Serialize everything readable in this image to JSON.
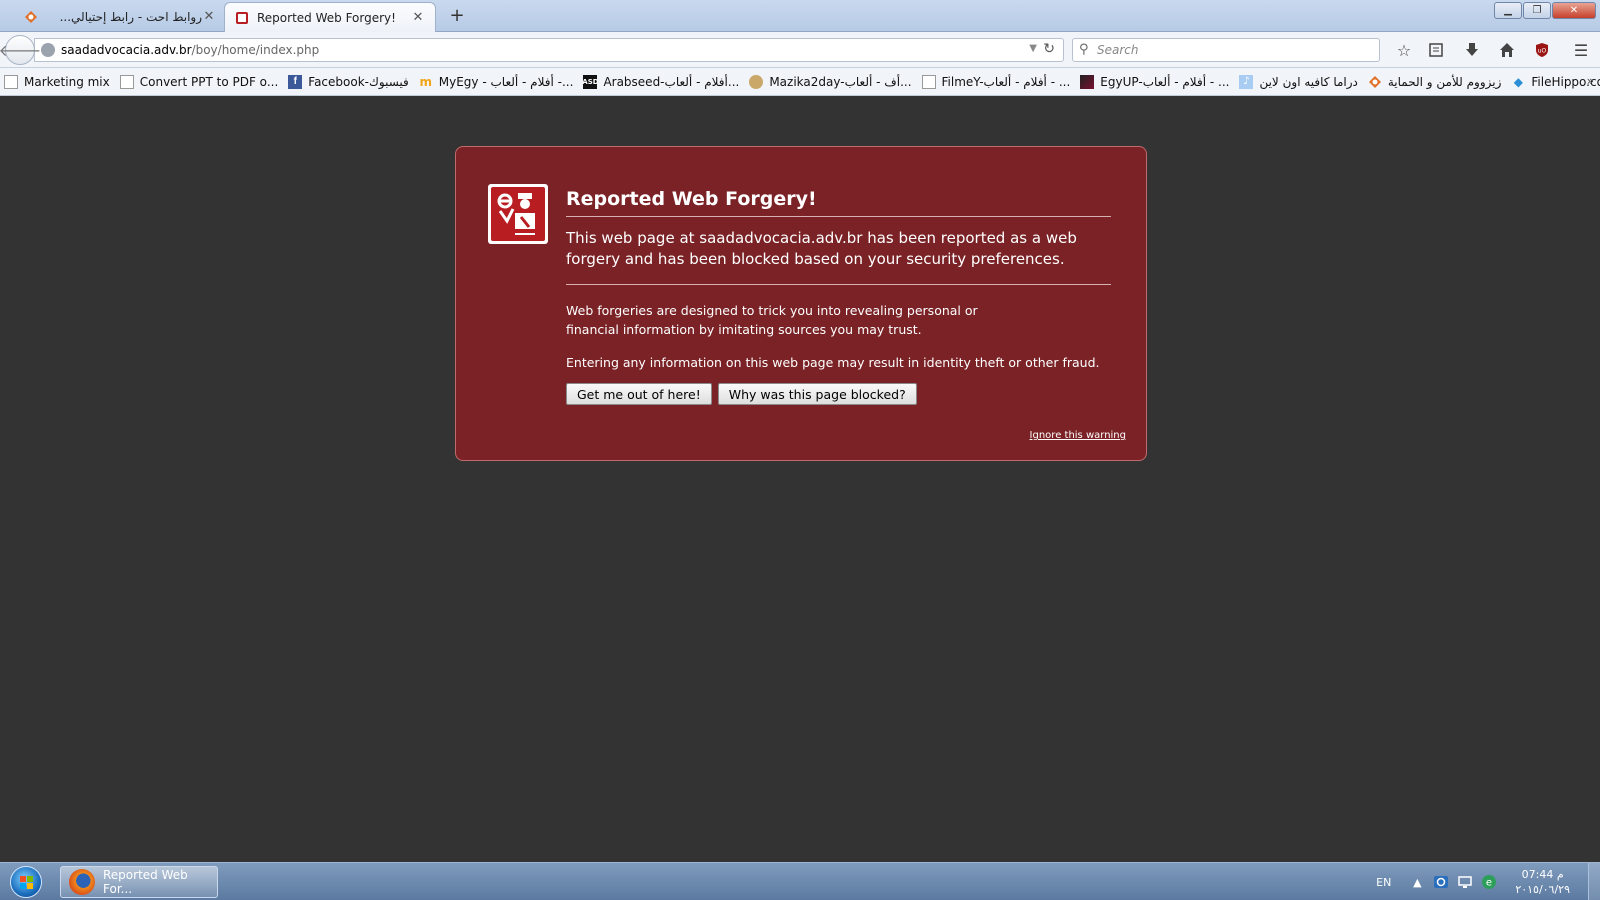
{
  "tabs": [
    {
      "title": "روابط احت - رابط إحتيالي...",
      "active": false
    },
    {
      "title": "Reported Web Forgery!",
      "active": true
    }
  ],
  "navbar": {
    "url_host": "saadadvocacia.adv.br",
    "url_path": "/boy/home/index.php",
    "search_placeholder": "Search"
  },
  "bookmarks": [
    {
      "label": "Marketing mix",
      "icon": "blank-page-icon"
    },
    {
      "label": "Convert PPT to PDF o...",
      "icon": "blank-page-icon"
    },
    {
      "label": "Facebook-فيسبوك",
      "icon": "facebook-icon"
    },
    {
      "label": "MyEgy - أفلام - ألعاب -...",
      "icon": "myegy-icon"
    },
    {
      "label": "Arabseed-أفلام - ألعاب...",
      "icon": "arabseed-icon"
    },
    {
      "label": "Mazika2day-أف - ألعاب...",
      "icon": "mazika-icon"
    },
    {
      "label": "FilmeY-أفلام - ألعاب - ...",
      "icon": "blank-page-icon"
    },
    {
      "label": "EgyUP-أفلام - ألعاب - ...",
      "icon": "egyup-icon"
    },
    {
      "label": "دراما كافيه اون لاين",
      "icon": "music-note-icon"
    },
    {
      "label": "زيزووم للأمن و الحماية",
      "icon": "zizoom-icon"
    },
    {
      "label": "FileHippo.com - Down...",
      "icon": "filehippo-icon"
    }
  ],
  "warning": {
    "title": "Reported Web Forgery!",
    "short_desc": "This web page at saadadvocacia.adv.br has been reported as a web forgery and has been blocked based on your security preferences.",
    "long_desc_1": "Web forgeries are designed to trick you into revealing personal or financial information by imitating sources you may trust.",
    "long_desc_2": "Entering any information on this web page may result in identity theft or other fraud.",
    "get_out_button": "Get me out of here!",
    "why_blocked_button": "Why was this page blocked?",
    "ignore_link": "Ignore this warning"
  },
  "taskbar": {
    "task_label": "Reported Web For...",
    "language": "EN",
    "time": "07:44 م",
    "date": "٢٠١٥/٠٦/٢٩"
  },
  "colors": {
    "page_background": "#333333",
    "warning_background": "#7a2226",
    "shield_red": "#b81d22"
  }
}
